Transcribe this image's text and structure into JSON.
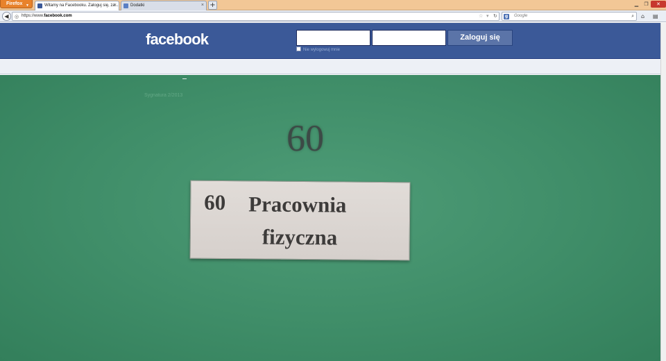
{
  "browser": {
    "menu_button": "Firefox",
    "tabs": [
      {
        "label": "Witamy na Facebooku. Zaloguj się, za...",
        "active": true,
        "favicon_color": "#3b5998"
      },
      {
        "label": "Dodatki",
        "active": false,
        "favicon_color": "#5a7fc4"
      }
    ],
    "new_tab": "+",
    "url_prefix": "https://www.",
    "url_domain": "facebook.com",
    "search_placeholder": "Google",
    "search_engine_letter": "g"
  },
  "facebook": {
    "logo": "facebook",
    "email_value": "",
    "password_value": "",
    "login_button": "Zaloguj się",
    "remember_label": "Nie wylogowuj mnie"
  },
  "content": {
    "faint_text": "Sygnatura 2/2013",
    "big_number": "60",
    "plate": {
      "number": "60",
      "line1": "Pracownia",
      "line2": "fizyczna"
    }
  },
  "colors": {
    "fb_blue": "#3b5998",
    "chalkboard_green": "#3f8d68",
    "firefox_orange": "#e8822b"
  }
}
